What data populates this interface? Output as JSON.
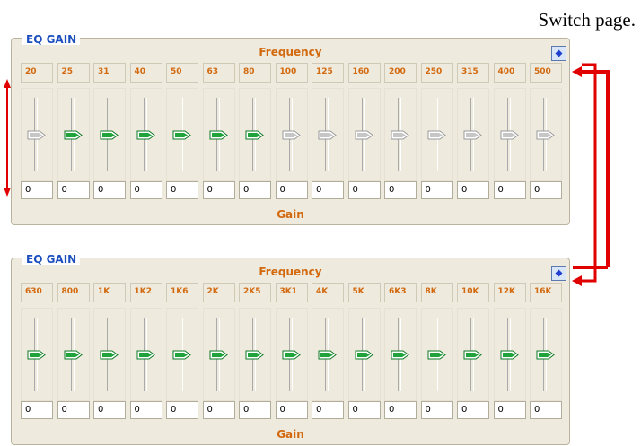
{
  "caption": "Switch page.",
  "pages": [
    {
      "title": "EQ GAIN",
      "frequency_label": "Frequency",
      "gain_label": "Gain",
      "bands": [
        {
          "label": "20",
          "value": "0",
          "active": false
        },
        {
          "label": "25",
          "value": "0",
          "active": true
        },
        {
          "label": "31",
          "value": "0",
          "active": true
        },
        {
          "label": "40",
          "value": "0",
          "active": true
        },
        {
          "label": "50",
          "value": "0",
          "active": true
        },
        {
          "label": "63",
          "value": "0",
          "active": true
        },
        {
          "label": "80",
          "value": "0",
          "active": true
        },
        {
          "label": "100",
          "value": "0",
          "active": false
        },
        {
          "label": "125",
          "value": "0",
          "active": false
        },
        {
          "label": "160",
          "value": "0",
          "active": false
        },
        {
          "label": "200",
          "value": "0",
          "active": false
        },
        {
          "label": "250",
          "value": "0",
          "active": false
        },
        {
          "label": "315",
          "value": "0",
          "active": false
        },
        {
          "label": "400",
          "value": "0",
          "active": false
        },
        {
          "label": "500",
          "value": "0",
          "active": false
        }
      ]
    },
    {
      "title": "EQ GAIN",
      "frequency_label": "Frequency",
      "gain_label": "Gain",
      "bands": [
        {
          "label": "630",
          "value": "0",
          "active": true
        },
        {
          "label": "800",
          "value": "0",
          "active": true
        },
        {
          "label": "1K",
          "value": "0",
          "active": true
        },
        {
          "label": "1K2",
          "value": "0",
          "active": true
        },
        {
          "label": "1K6",
          "value": "0",
          "active": true
        },
        {
          "label": "2K",
          "value": "0",
          "active": true
        },
        {
          "label": "2K5",
          "value": "0",
          "active": true
        },
        {
          "label": "3K1",
          "value": "0",
          "active": true
        },
        {
          "label": "4K",
          "value": "0",
          "active": true
        },
        {
          "label": "5K",
          "value": "0",
          "active": true
        },
        {
          "label": "6K3",
          "value": "0",
          "active": true
        },
        {
          "label": "8K",
          "value": "0",
          "active": true
        },
        {
          "label": "10K",
          "value": "0",
          "active": true
        },
        {
          "label": "12K",
          "value": "0",
          "active": true
        },
        {
          "label": "16K",
          "value": "0",
          "active": true
        }
      ]
    }
  ],
  "colors": {
    "title_blue": "#1c4fbd",
    "label_orange": "#d3690e",
    "thumb_active": "#1fa33a",
    "thumb_inactive": "#c6c6c6",
    "annotation_red": "#e00000",
    "panel_bg": "#eeeadd"
  },
  "icons": {
    "switch_page": "switch-page-icon",
    "thumb": "slider-thumb-icon",
    "range_arrow": "vertical-double-arrow-icon"
  }
}
